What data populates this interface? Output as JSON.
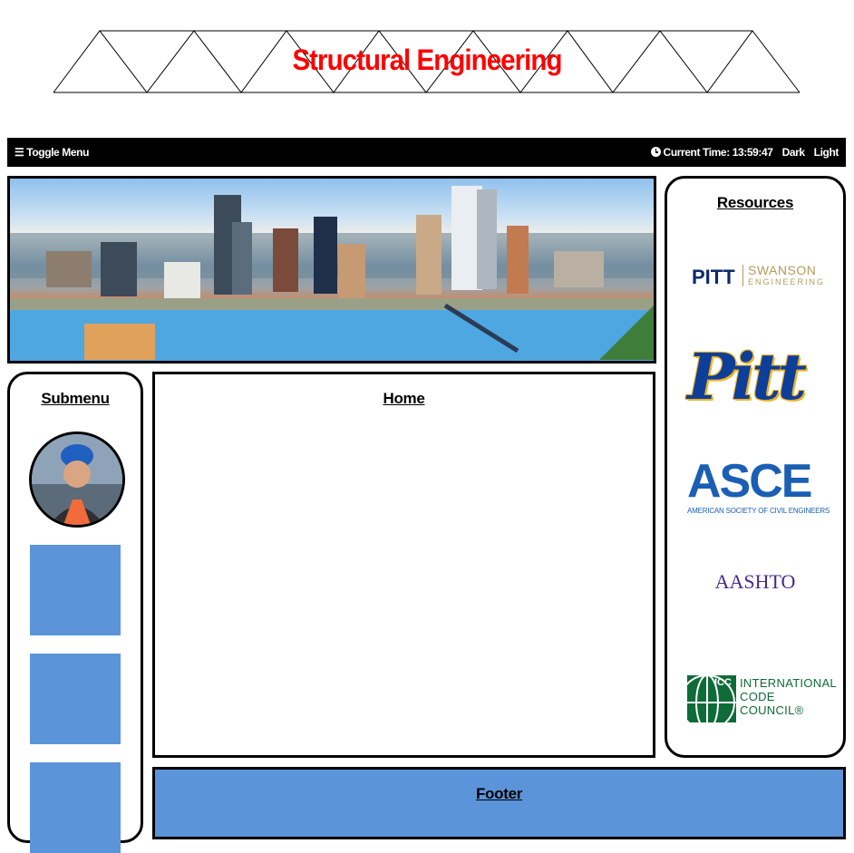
{
  "site": {
    "title": "Structural Engineering"
  },
  "nav": {
    "toggle_label": "☰ Toggle Menu",
    "time_label": "Current Time: 13:59:47",
    "dark_label": "Dark",
    "light_label": "Light"
  },
  "banner": {
    "description_hidden": ""
  },
  "submenu": {
    "title": "Submenu"
  },
  "home": {
    "title": "Home"
  },
  "resources": {
    "title": "Resources",
    "logos": {
      "pitt_swanson": {
        "main": "PITT",
        "name": "SWANSON",
        "sub": "ENGINEERING"
      },
      "pitt": "Pitt",
      "asce": {
        "main": "ASCE",
        "sub": "AMERICAN SOCIETY OF CIVIL ENGINEERS"
      },
      "aashto": "AASHTO",
      "icc": {
        "box": "ICC",
        "line1": "INTERNATIONAL",
        "line2": "CODE",
        "line3": "COUNCIL®"
      }
    }
  },
  "footer": {
    "title": "Footer"
  },
  "colors": {
    "title_red": "#ff0000",
    "panel_blue": "#5b94d9",
    "nav_black": "#000000"
  }
}
